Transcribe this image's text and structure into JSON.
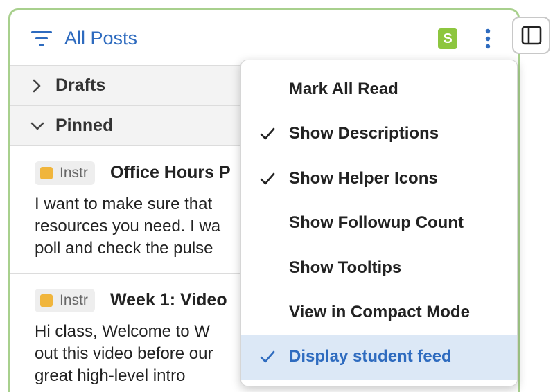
{
  "header": {
    "title": "All Posts",
    "avatar_initial": "S",
    "avatar_color": "#8dc63f"
  },
  "sections": [
    {
      "label": "Drafts",
      "expanded": false
    },
    {
      "label": "Pinned",
      "expanded": true
    }
  ],
  "posts": [
    {
      "badge": "Instr",
      "title": "Office Hours P",
      "body": "I want to make sure that\nresources you need. I wa\npoll and check the pulse"
    },
    {
      "badge": "Instr",
      "title": "Week 1: Video",
      "body": "Hi class,  Welcome to W\nout this video before our\ngreat high-level intro"
    }
  ],
  "menu": {
    "items": [
      {
        "label": "Mark All Read",
        "checked": false,
        "highlighted": false
      },
      {
        "label": "Show Descriptions",
        "checked": true,
        "highlighted": false
      },
      {
        "label": "Show Helper Icons",
        "checked": true,
        "highlighted": false
      },
      {
        "label": "Show Followup Count",
        "checked": false,
        "highlighted": false
      },
      {
        "label": "Show Tooltips",
        "checked": false,
        "highlighted": false
      },
      {
        "label": "View in Compact Mode",
        "checked": false,
        "highlighted": false
      },
      {
        "label": "Display student feed",
        "checked": true,
        "highlighted": true
      }
    ]
  },
  "colors": {
    "accent": "#2e6bbf",
    "panel_border": "#a8d08d",
    "instructor_badge": "#f0b53c",
    "highlight": "#dce8f6"
  },
  "icons": {
    "filter": "filter-icon",
    "more": "kebab-menu-icon",
    "sidebar": "sidebar-toggle-icon",
    "collapsed": "chevron-right-icon",
    "expanded": "chevron-down-icon",
    "check": "checkmark-icon"
  }
}
